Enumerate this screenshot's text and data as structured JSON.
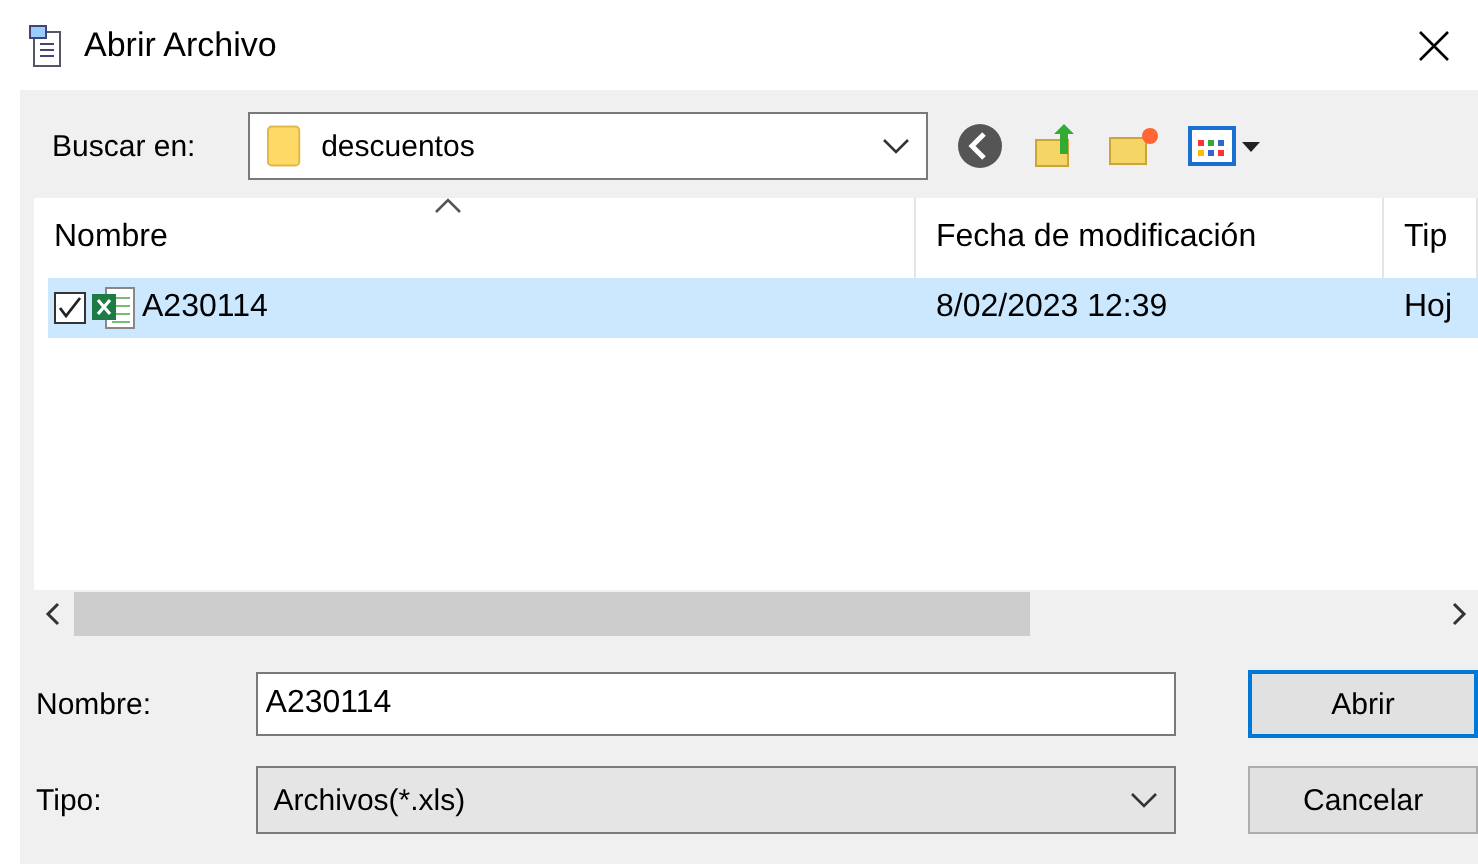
{
  "window": {
    "title": "Abrir Archivo"
  },
  "look_in": {
    "label": "Buscar en:",
    "value": "descuentos"
  },
  "list": {
    "columns": [
      {
        "label": "Nombre",
        "sorted": true
      },
      {
        "label": "Fecha de modificación",
        "sorted": false
      },
      {
        "label": "Tip",
        "sorted": false
      }
    ],
    "rows": [
      {
        "checked": true,
        "selected": true,
        "name": "A230114",
        "date": "8/02/2023 12:39",
        "type": "Hoj"
      }
    ]
  },
  "name_field": {
    "label": "Nombre:",
    "value": "A230114"
  },
  "type_field": {
    "label": "Tipo:",
    "value": "Archivos(*.xls)"
  },
  "buttons": [
    {
      "label": "Abrir",
      "default": true
    },
    {
      "label": "Cancelar",
      "default": false
    }
  ]
}
